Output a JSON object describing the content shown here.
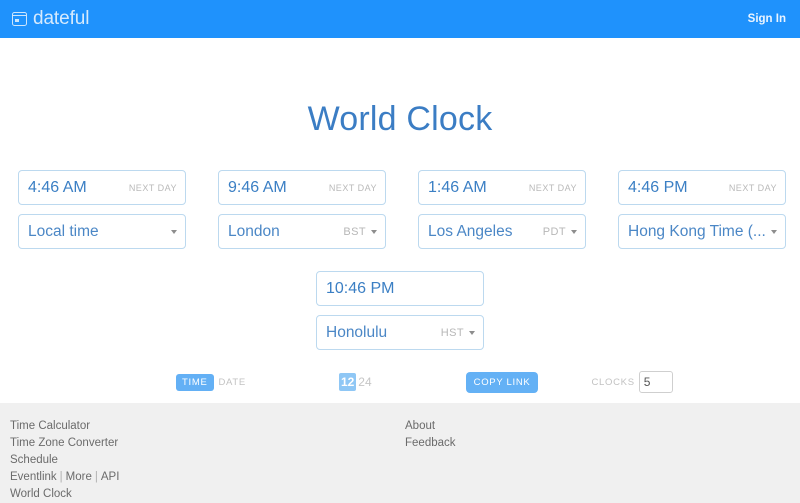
{
  "header": {
    "brand": "dateful",
    "brand_icon": "calendar-icon",
    "signin": "Sign In",
    "bg_color": "#1f92fc"
  },
  "main": {
    "title": "World Clock",
    "title_color": "#3b7dc4"
  },
  "clocks": [
    {
      "time": "4:46 AM",
      "next_day": "NEXT DAY",
      "zone": "Local time",
      "abbr": ""
    },
    {
      "time": "9:46 AM",
      "next_day": "NEXT DAY",
      "zone": "London",
      "abbr": "BST"
    },
    {
      "time": "1:46 AM",
      "next_day": "NEXT DAY",
      "zone": "Los Angeles",
      "abbr": "PDT"
    },
    {
      "time": "4:46 PM",
      "next_day": "NEXT DAY",
      "zone": "Hong Kong Time (...",
      "abbr": ""
    },
    {
      "time": "10:46 PM",
      "next_day": "",
      "zone": "Honolulu",
      "abbr": "HST"
    }
  ],
  "controls": {
    "mode_time": "TIME",
    "mode_date": "DATE",
    "format_12": "12",
    "format_24": "24",
    "copy_link": "COPY LINK",
    "clocks_label": "CLOCKS",
    "clocks_value": "5",
    "active_accent": "#63b0f5"
  },
  "footer": {
    "col1": {
      "time_calculator": "Time Calculator",
      "time_zone_converter": "Time Zone Converter",
      "schedule": "Schedule",
      "eventlink": "Eventlink",
      "more": "More",
      "api": "API",
      "world_clock": "World Clock",
      "sep": "|"
    },
    "col2": {
      "about": "About",
      "feedback": "Feedback"
    }
  }
}
